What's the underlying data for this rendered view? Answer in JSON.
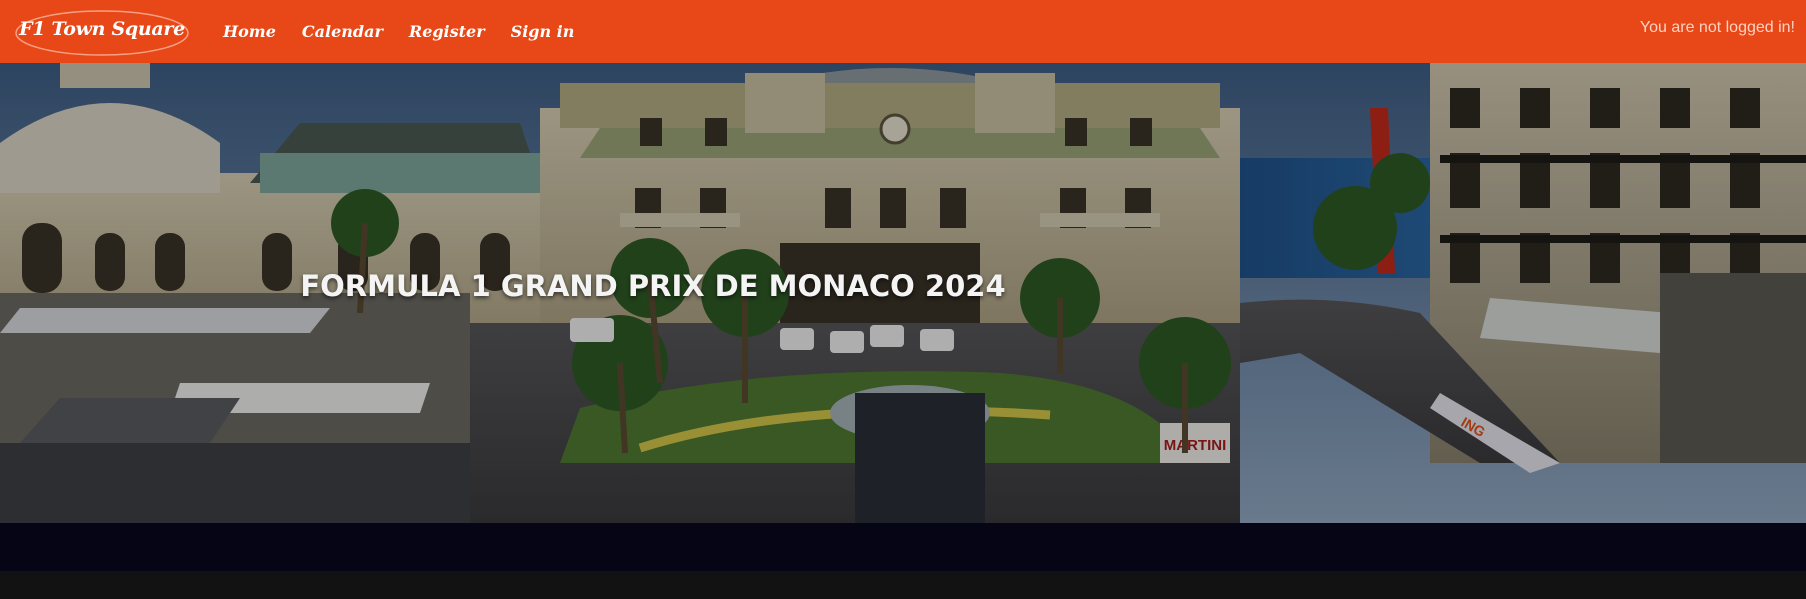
{
  "navbar": {
    "brand": "F1 Town Square",
    "links": [
      "Home",
      "Calendar",
      "Register",
      "Sign in"
    ],
    "status": "You are not logged in!"
  },
  "hero": {
    "title": "FORMULA 1 GRAND PRIX DE MONACO 2024",
    "image": "monaco-casino-square-photo",
    "signs": {
      "martini": "MARTINI",
      "ing": "ING"
    }
  },
  "colors": {
    "navbar": "#e84817",
    "band": "#050516",
    "page": "#121212"
  }
}
